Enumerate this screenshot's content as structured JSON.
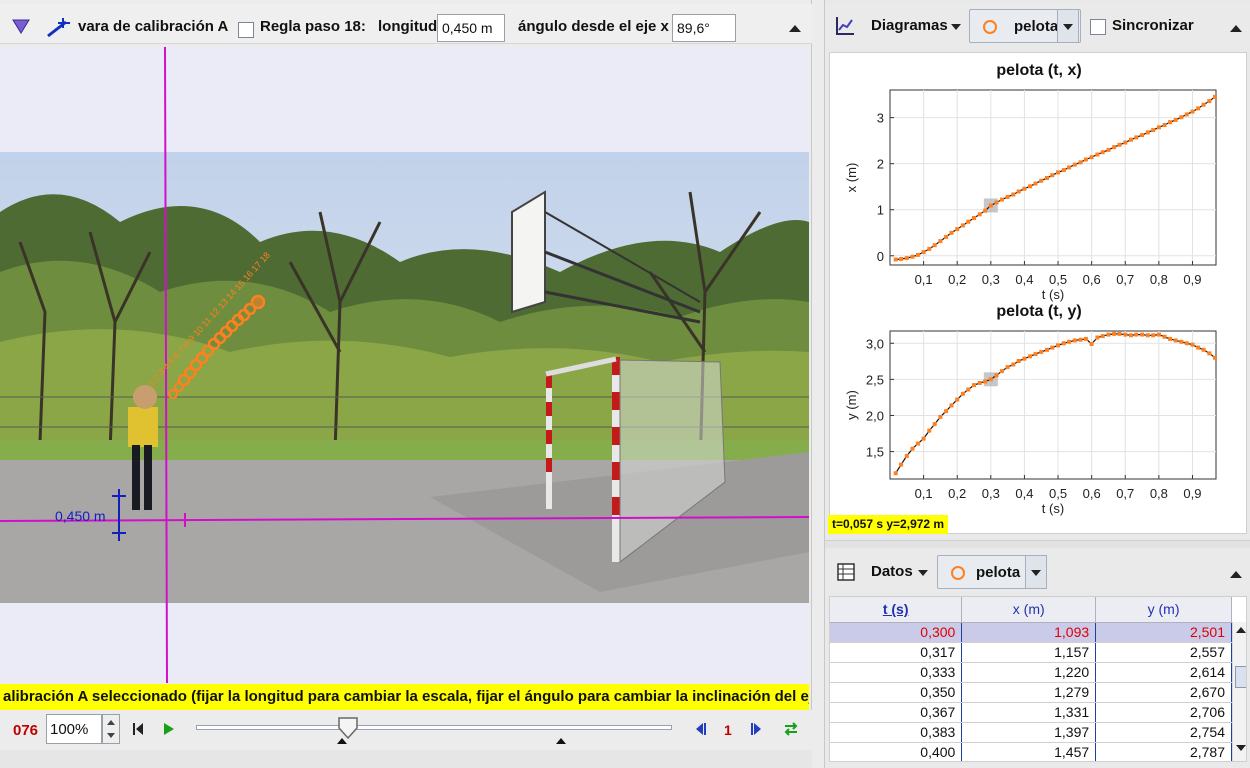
{
  "video_toolbar": {
    "tool_name": "vara de calibración A",
    "ruler_label": "Regla paso 18:",
    "length_label": "longitud",
    "length_value": "0,450 m",
    "angle_label": "ángulo desde el eje x",
    "angle_value": "89,6°"
  },
  "video": {
    "stick_label": "0,450 m",
    "status_message": "alibración A seleccionado (fijar la longitud para cambiar la escala, fijar el ángulo para cambiar la inclinación del eje)"
  },
  "player": {
    "frame_number": "076",
    "zoom": "100%",
    "step_size": "1",
    "slider_position": 0.32
  },
  "plots_bar": {
    "view_label": "Diagramas",
    "track_name": "pelota",
    "sync_label": "Sincronizar"
  },
  "readout": "t=0,057 s  y=2,972 m",
  "chart_data": [
    {
      "type": "scatter",
      "title": "pelota (t, x)",
      "xlabel": "t (s)",
      "ylabel": "x (m)",
      "xlim": [
        0,
        0.97
      ],
      "ylim": [
        -0.2,
        3.6
      ],
      "xticks": [
        "0,1",
        "0,2",
        "0,3",
        "0,4",
        "0,5",
        "0,6",
        "0,7",
        "0,8",
        "0,9"
      ],
      "yticks": [
        "0",
        "1",
        "2",
        "3"
      ],
      "x": [
        0.017,
        0.033,
        0.05,
        0.067,
        0.083,
        0.1,
        0.117,
        0.133,
        0.15,
        0.167,
        0.183,
        0.2,
        0.217,
        0.233,
        0.25,
        0.267,
        0.283,
        0.3,
        0.317,
        0.333,
        0.35,
        0.367,
        0.383,
        0.4,
        0.417,
        0.433,
        0.45,
        0.467,
        0.483,
        0.5,
        0.517,
        0.533,
        0.55,
        0.567,
        0.583,
        0.6,
        0.617,
        0.633,
        0.65,
        0.667,
        0.683,
        0.7,
        0.717,
        0.733,
        0.75,
        0.767,
        0.783,
        0.8,
        0.817,
        0.833,
        0.85,
        0.867,
        0.883,
        0.9,
        0.917,
        0.933,
        0.95,
        0.967
      ],
      "y": [
        -0.08,
        -0.07,
        -0.05,
        -0.02,
        0.02,
        0.08,
        0.15,
        0.23,
        0.32,
        0.41,
        0.5,
        0.58,
        0.66,
        0.74,
        0.82,
        0.9,
        0.98,
        1.093,
        1.157,
        1.22,
        1.279,
        1.331,
        1.397,
        1.457,
        1.51,
        1.57,
        1.63,
        1.69,
        1.75,
        1.81,
        1.86,
        1.92,
        1.98,
        2.03,
        2.09,
        2.14,
        2.2,
        2.25,
        2.3,
        2.36,
        2.41,
        2.46,
        2.52,
        2.57,
        2.62,
        2.68,
        2.73,
        2.79,
        2.84,
        2.9,
        2.95,
        3.01,
        3.07,
        3.13,
        3.2,
        3.28,
        3.36,
        3.45
      ],
      "highlight": {
        "x": 0.3,
        "y": 1.093
      },
      "grid": true
    },
    {
      "type": "scatter",
      "title": "pelota (t, y)",
      "xlabel": "t (s)",
      "ylabel": "y (m)",
      "xlim": [
        0,
        0.97
      ],
      "ylim": [
        1.12,
        3.17
      ],
      "xticks": [
        "0,1",
        "0,2",
        "0,3",
        "0,4",
        "0,5",
        "0,6",
        "0,7",
        "0,8",
        "0,9"
      ],
      "yticks": [
        "1,5",
        "2,0",
        "2,5",
        "3,0"
      ],
      "x": [
        0.017,
        0.033,
        0.05,
        0.067,
        0.083,
        0.1,
        0.117,
        0.133,
        0.15,
        0.167,
        0.183,
        0.2,
        0.217,
        0.233,
        0.25,
        0.267,
        0.283,
        0.3,
        0.317,
        0.333,
        0.35,
        0.367,
        0.383,
        0.4,
        0.417,
        0.433,
        0.45,
        0.467,
        0.483,
        0.5,
        0.517,
        0.533,
        0.55,
        0.567,
        0.583,
        0.6,
        0.617,
        0.633,
        0.65,
        0.667,
        0.683,
        0.7,
        0.717,
        0.733,
        0.75,
        0.767,
        0.783,
        0.8,
        0.817,
        0.833,
        0.85,
        0.867,
        0.883,
        0.9,
        0.917,
        0.933,
        0.95,
        0.967
      ],
      "y": [
        1.2,
        1.32,
        1.44,
        1.54,
        1.61,
        1.68,
        1.79,
        1.88,
        1.98,
        2.06,
        2.14,
        2.22,
        2.3,
        2.36,
        2.42,
        2.45,
        2.47,
        2.501,
        2.557,
        2.614,
        2.67,
        2.706,
        2.754,
        2.787,
        2.82,
        2.85,
        2.88,
        2.91,
        2.94,
        2.97,
        3.0,
        3.02,
        3.04,
        3.05,
        3.06,
        2.99,
        3.08,
        3.1,
        3.12,
        3.13,
        3.13,
        3.12,
        3.11,
        3.12,
        3.12,
        3.11,
        3.11,
        3.12,
        3.09,
        3.06,
        3.04,
        3.02,
        3.0,
        2.98,
        2.94,
        2.91,
        2.86,
        2.8
      ],
      "highlight": {
        "x": 0.3,
        "y": 2.501
      },
      "grid": true
    }
  ],
  "table_bar": {
    "view_label": "Datos",
    "track_name": "pelota"
  },
  "table": {
    "headers": [
      "t (s)",
      "x (m)",
      "y (m)"
    ],
    "rows": [
      [
        "0,300",
        "1,093",
        "2,501"
      ],
      [
        "0,317",
        "1,157",
        "2,557"
      ],
      [
        "0,333",
        "1,220",
        "2,614"
      ],
      [
        "0,350",
        "1,279",
        "2,670"
      ],
      [
        "0,367",
        "1,331",
        "2,706"
      ],
      [
        "0,383",
        "1,397",
        "2,754"
      ],
      [
        "0,400",
        "1,457",
        "2,787"
      ]
    ]
  },
  "colors": {
    "axis_magenta": "#d010c8",
    "track_orange": "#ff8020",
    "calib_blue": "#1020c0",
    "highlight_yellow": "#ffff00"
  }
}
